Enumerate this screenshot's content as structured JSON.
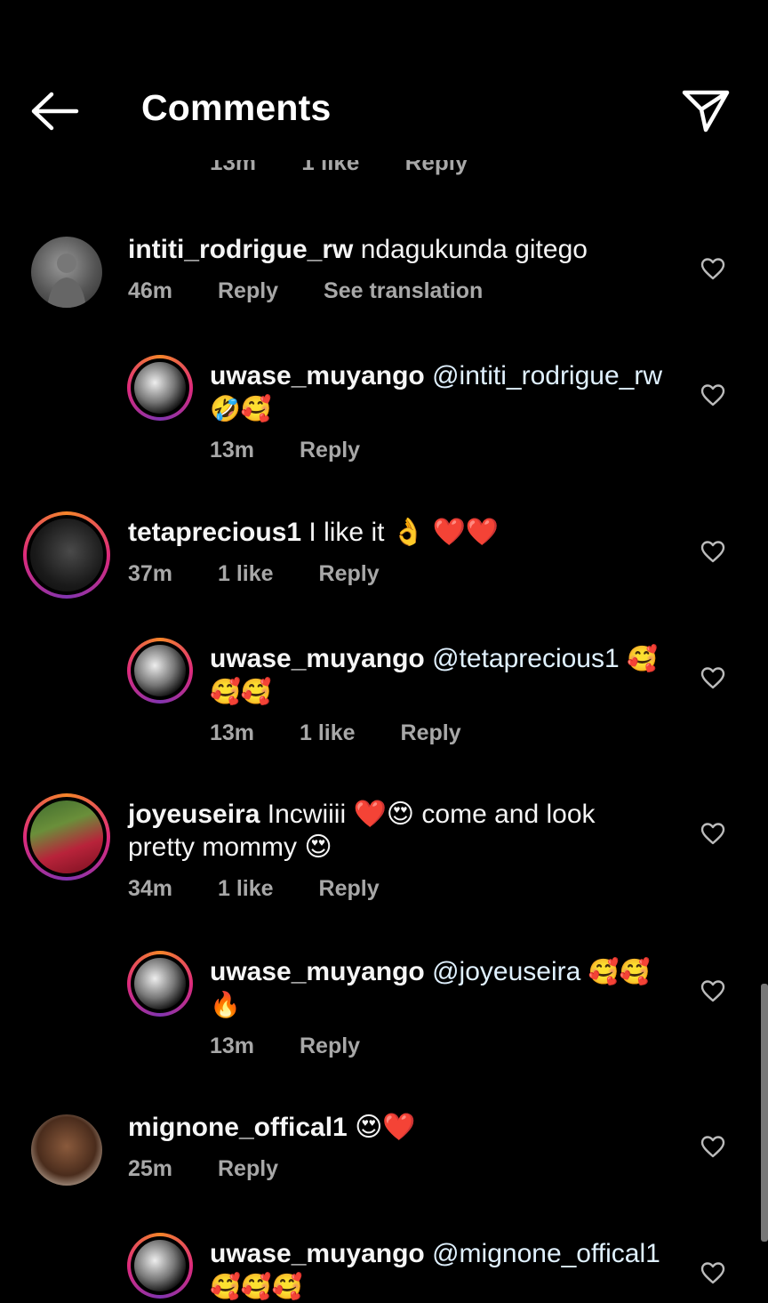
{
  "header": {
    "title": "Comments"
  },
  "partial_meta": {
    "time": "13m",
    "likes": "1 like",
    "reply": "Reply"
  },
  "comments": [
    {
      "username": "intiti_rodrigue_rw",
      "text": "ndagukunda gitego",
      "time": "46m",
      "reply": "Reply",
      "translate": "See translation"
    },
    {
      "username": "uwase_muyango",
      "mention": "@intiti_rodrigue_rw",
      "text": "🤣🥰",
      "time": "13m",
      "reply": "Reply"
    },
    {
      "username": "tetaprecious1",
      "text": "I like it 👌 ❤️❤️",
      "time": "37m",
      "likes": "1 like",
      "reply": "Reply"
    },
    {
      "username": "uwase_muyango",
      "mention": "@tetaprecious1",
      "text": "🥰🥰🥰",
      "time": "13m",
      "likes": "1 like",
      "reply": "Reply"
    },
    {
      "username": "joyeuseira",
      "text": "Incwiiii ❤️😍 come and look pretty mommy 😍",
      "time": "34m",
      "likes": "1 like",
      "reply": "Reply"
    },
    {
      "username": "uwase_muyango",
      "mention": "@joyeuseira",
      "text": "🥰🥰🔥",
      "time": "13m",
      "reply": "Reply"
    },
    {
      "username": "mignone_offical1",
      "text": "😍❤️",
      "time": "25m",
      "reply": "Reply"
    },
    {
      "username": "uwase_muyango",
      "mention": "@mignone_offical1",
      "text": "🥰🥰🥰"
    }
  ],
  "colors": {
    "background": "#000000",
    "meta": "#a8a8a8",
    "text": "#f5f5f5"
  }
}
